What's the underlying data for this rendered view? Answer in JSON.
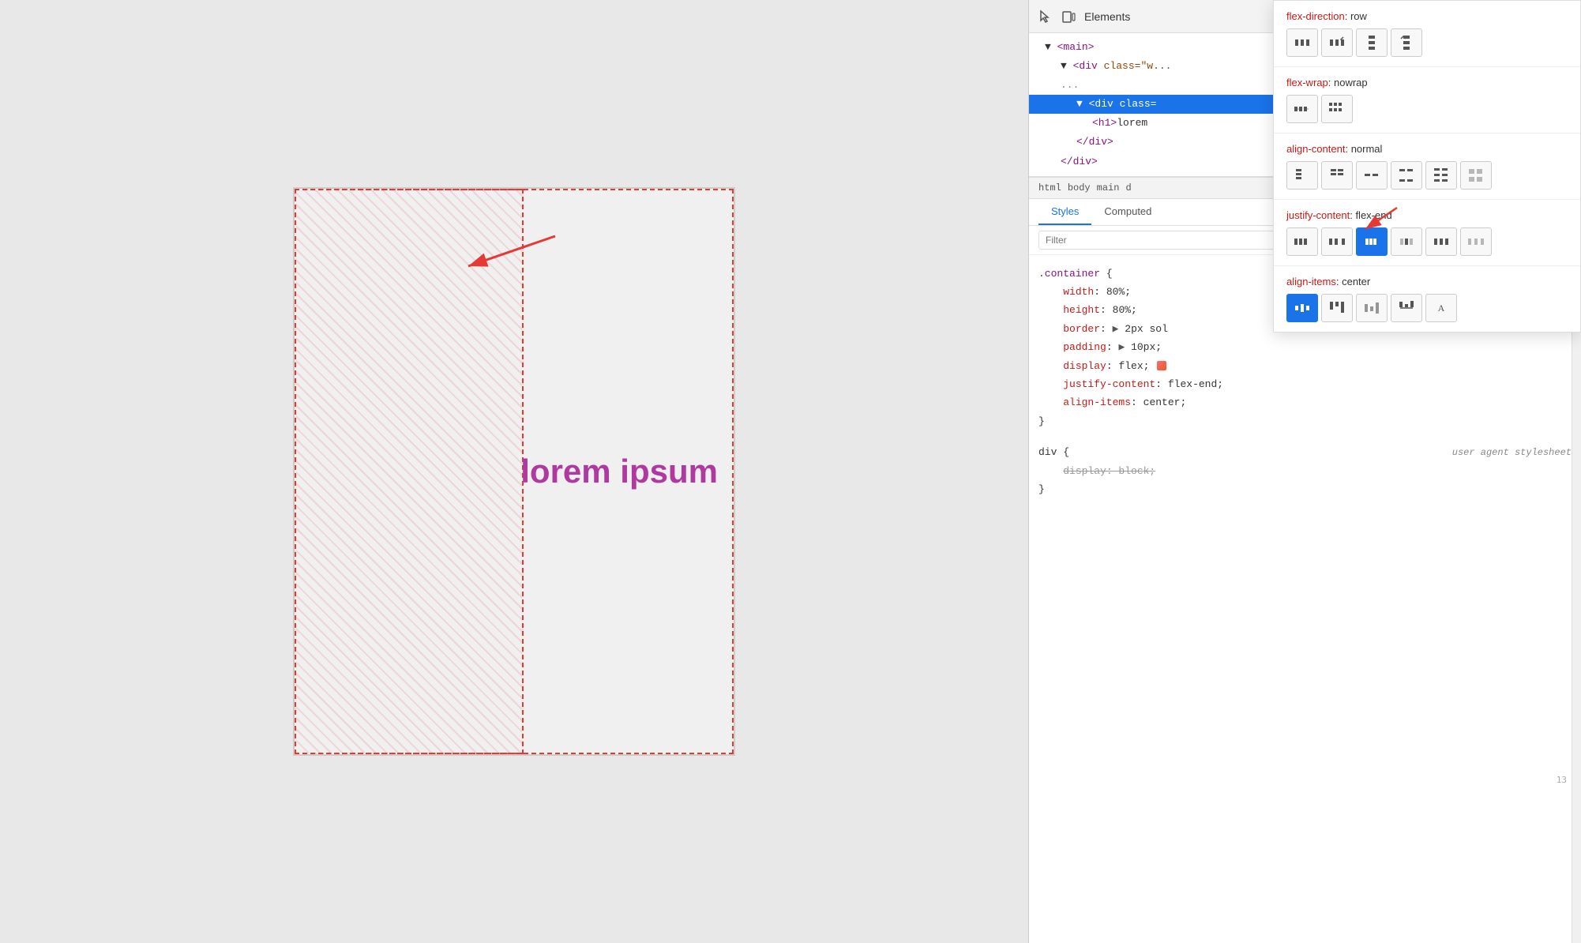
{
  "preview": {
    "lorem_text": "lorem ipsum"
  },
  "devtools": {
    "toolbar": {
      "active_panel": "Elements"
    },
    "html_tree": {
      "lines": [
        {
          "indent": 1,
          "content": "▼ <main>",
          "selected": false
        },
        {
          "indent": 2,
          "content": "▼ <div class=\"w...",
          "selected": false
        },
        {
          "indent": 2,
          "content": "...",
          "selected": false
        },
        {
          "indent": 3,
          "content": "▼ <div class=",
          "selected": true
        },
        {
          "indent": 4,
          "content": "<h1>lorem",
          "selected": false
        },
        {
          "indent": 3,
          "content": "</div>",
          "selected": false
        },
        {
          "indent": 2,
          "content": "</div>",
          "selected": false
        }
      ]
    },
    "breadcrumb": {
      "items": [
        "html",
        "body",
        "main",
        "d"
      ]
    },
    "tabs": {
      "styles_label": "Styles",
      "computed_label": "Computed"
    },
    "filter": {
      "placeholder": "Filter"
    },
    "css_rules": {
      "container_selector": ".container {",
      "properties": [
        {
          "name": "width",
          "value": "80%",
          "strikethrough": false
        },
        {
          "name": "height",
          "value": "80%",
          "strikethrough": false
        },
        {
          "name": "border",
          "value": "▶ 2px sol",
          "strikethrough": false
        },
        {
          "name": "padding",
          "value": "▶ 10px",
          "strikethrough": false
        },
        {
          "name": "display",
          "value": "flex",
          "strikethrough": false,
          "has_icon": true
        },
        {
          "name": "justify-content",
          "value": "flex-end",
          "strikethrough": false
        },
        {
          "name": "align-items",
          "value": "center",
          "strikethrough": false
        }
      ],
      "close_brace": "}",
      "div_selector": "div {",
      "ua_label": "user agent stylesheet",
      "ua_properties": [
        {
          "name": "display",
          "value": "block",
          "strikethrough": true
        }
      ],
      "ua_close_brace": "}"
    }
  },
  "flex_inspector": {
    "properties": [
      {
        "name": "flex-direction",
        "colon": ":",
        "value": "row",
        "buttons": [
          {
            "icon": "row",
            "active": false
          },
          {
            "icon": "row-reverse",
            "active": false
          },
          {
            "icon": "column",
            "active": false
          },
          {
            "icon": "column-reverse",
            "active": false
          }
        ]
      },
      {
        "name": "flex-wrap",
        "colon": ":",
        "value": "nowrap",
        "buttons": [
          {
            "icon": "nowrap",
            "active": false
          },
          {
            "icon": "wrap",
            "active": false
          }
        ]
      },
      {
        "name": "align-content",
        "colon": ":",
        "value": "normal",
        "buttons": [
          {
            "icon": "ac1",
            "active": false
          },
          {
            "icon": "ac2",
            "active": false
          },
          {
            "icon": "ac3",
            "active": false
          },
          {
            "icon": "ac4",
            "active": false
          },
          {
            "icon": "ac5",
            "active": false
          },
          {
            "icon": "ac6",
            "active": false
          }
        ]
      },
      {
        "name": "justify-content",
        "colon": ":",
        "value": "flex-end",
        "buttons": [
          {
            "icon": "jc1",
            "active": false
          },
          {
            "icon": "jc2",
            "active": false
          },
          {
            "icon": "jc3",
            "active": true
          },
          {
            "icon": "jc4",
            "active": false
          },
          {
            "icon": "jc5",
            "active": false
          },
          {
            "icon": "jc6",
            "active": false
          }
        ]
      },
      {
        "name": "align-items",
        "colon": ":",
        "value": "center",
        "buttons": [
          {
            "icon": "ai1",
            "active": true
          },
          {
            "icon": "ai2",
            "active": false
          },
          {
            "icon": "ai3",
            "active": false
          },
          {
            "icon": "ai4",
            "active": false
          },
          {
            "icon": "ai5",
            "active": false
          }
        ]
      }
    ]
  }
}
